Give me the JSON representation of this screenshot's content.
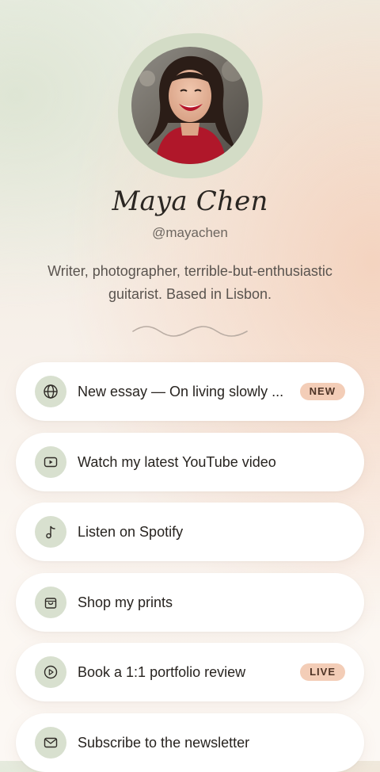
{
  "profile": {
    "name": "Maya Chen",
    "handle": "@mayachen",
    "bio": "Writer, photographer, terrible-but-enthusiastic guitarist. Based in Lisbon."
  },
  "links": [
    {
      "label": "New essay — On living slowly ...",
      "icon": "globe-icon",
      "badge": "NEW"
    },
    {
      "label": "Watch my latest YouTube video",
      "icon": "video-icon",
      "badge": ""
    },
    {
      "label": "Listen on Spotify",
      "icon": "music-note-icon",
      "badge": ""
    },
    {
      "label": "Shop my prints",
      "icon": "shopping-bag-icon",
      "badge": ""
    },
    {
      "label": "Book a 1:1 portfolio review",
      "icon": "play-circle-icon",
      "badge": "LIVE"
    },
    {
      "label": "Subscribe to the newsletter",
      "icon": "mail-icon",
      "badge": ""
    }
  ],
  "colors": {
    "accent_sage": "#d8e0cf",
    "badge_peach": "#f3cdb7",
    "text_dark": "#27231f"
  }
}
